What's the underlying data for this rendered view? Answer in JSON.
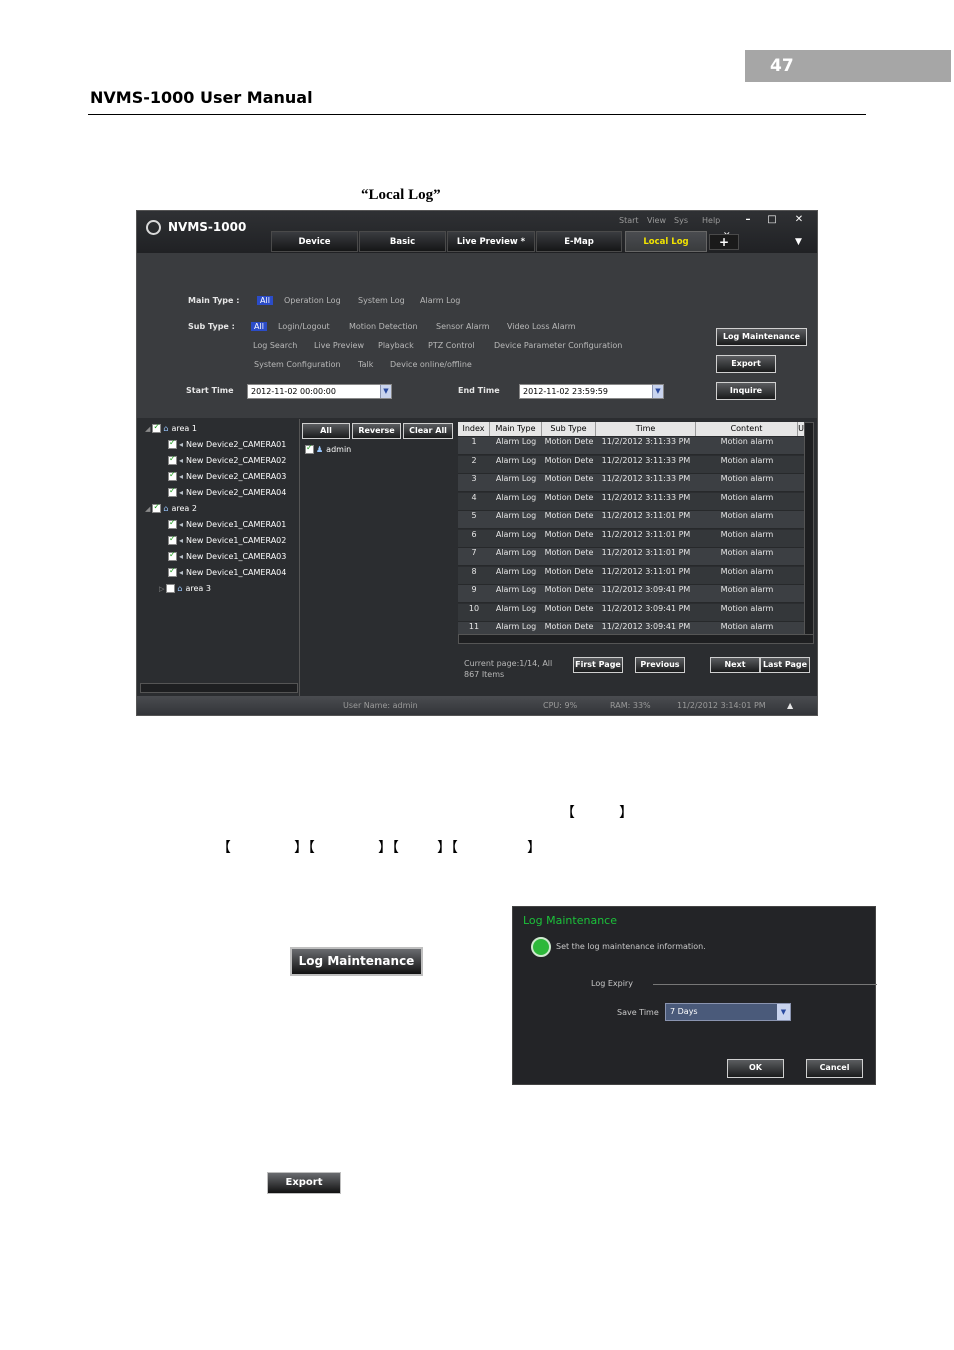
{
  "page": {
    "number": "47",
    "manual_title": "NVMS-1000 User Manual",
    "caption": "“Local Log”"
  },
  "app": {
    "title": "NVMS-1000",
    "menu": [
      "Start",
      "View",
      "Sys",
      "Help"
    ],
    "window_buttons": [
      "–",
      "□",
      "✕"
    ],
    "tabs": [
      "Device",
      "Basic",
      "Live Preview *",
      "E-Map",
      "Local Log"
    ],
    "tab_close": "✕",
    "tab_add": "+",
    "tab_menu": "▼",
    "filters": {
      "main_type_label": "Main Type :",
      "main_types": [
        "All",
        "Operation Log",
        "System Log",
        "Alarm Log"
      ],
      "sub_type_label": "Sub Type :",
      "sub_types_row1": [
        "All",
        "Login/Logout",
        "Motion Detection",
        "Sensor Alarm",
        "Video Loss Alarm"
      ],
      "sub_types_row2": [
        "Log Search",
        "Live Preview",
        "Playback",
        "PTZ Control",
        "Device Parameter Configuration"
      ],
      "sub_types_row3": [
        "System Configuration",
        "Talk",
        "Device online/offline"
      ],
      "start_time_label": "Start Time",
      "start_time": "2012-11-02 00:00:00",
      "end_time_label": "End Time",
      "end_time": "2012-11-02 23:59:59",
      "log_maintenance": "Log Maintenance",
      "export": "Export",
      "inquire": "Inquire"
    },
    "tree": {
      "areas": [
        {
          "name": "area 1",
          "cameras": [
            "New Device2_CAMERA01",
            "New Device2_CAMERA02",
            "New Device2_CAMERA03",
            "New Device2_CAMERA04"
          ]
        },
        {
          "name": "area 2",
          "cameras": [
            "New Device1_CAMERA01",
            "New Device1_CAMERA02",
            "New Device1_CAMERA03",
            "New Device1_CAMERA04"
          ]
        },
        {
          "name": "area 3",
          "cameras": []
        }
      ]
    },
    "users": {
      "all": "All",
      "reverse": "Reverse",
      "clear_all": "Clear All",
      "items": [
        "admin"
      ]
    },
    "table": {
      "columns": [
        "Index",
        "Main Type",
        "Sub Type",
        "Time",
        "Content",
        "U"
      ],
      "rows": [
        [
          "1",
          "Alarm Log",
          "Motion Dete",
          "11/2/2012 3:11:33 PM",
          "Motion alarm"
        ],
        [
          "2",
          "Alarm Log",
          "Motion Dete",
          "11/2/2012 3:11:33 PM",
          "Motion alarm"
        ],
        [
          "3",
          "Alarm Log",
          "Motion Dete",
          "11/2/2012 3:11:33 PM",
          "Motion alarm"
        ],
        [
          "4",
          "Alarm Log",
          "Motion Dete",
          "11/2/2012 3:11:33 PM",
          "Motion alarm"
        ],
        [
          "5",
          "Alarm Log",
          "Motion Dete",
          "11/2/2012 3:11:01 PM",
          "Motion alarm"
        ],
        [
          "6",
          "Alarm Log",
          "Motion Dete",
          "11/2/2012 3:11:01 PM",
          "Motion alarm"
        ],
        [
          "7",
          "Alarm Log",
          "Motion Dete",
          "11/2/2012 3:11:01 PM",
          "Motion alarm"
        ],
        [
          "8",
          "Alarm Log",
          "Motion Dete",
          "11/2/2012 3:11:01 PM",
          "Motion alarm"
        ],
        [
          "9",
          "Alarm Log",
          "Motion Dete",
          "11/2/2012 3:09:41 PM",
          "Motion alarm"
        ],
        [
          "10",
          "Alarm Log",
          "Motion Dete",
          "11/2/2012 3:09:41 PM",
          "Motion alarm"
        ],
        [
          "11",
          "Alarm Log",
          "Motion Dete",
          "11/2/2012 3:09:41 PM",
          "Motion alarm"
        ]
      ]
    },
    "pager": {
      "line1": "Current page:1/14, All",
      "line2": "867 Items",
      "first": "First Page",
      "previous": "Previous",
      "next": "Next",
      "last": "Last Page"
    },
    "status": {
      "user": "User Name: admin",
      "cpu": "CPU: 9%",
      "ram": "RAM: 33%",
      "datetime": "11/2/2012 3:14:01 PM",
      "toggle": "▲"
    }
  },
  "brackets": {
    "line1": [
      "【",
      "】"
    ],
    "line2": [
      "【",
      "】【",
      "】【",
      "】【",
      "】"
    ]
  },
  "log_maintenance_button": "Log Maintenance",
  "dialog": {
    "title": "Log Maintenance",
    "info": "Set the log maintenance information.",
    "group": "Log Expiry",
    "save_time_label": "Save Time",
    "save_time_value": "7 Days",
    "ok": "OK",
    "cancel": "Cancel"
  },
  "export_button": "Export"
}
